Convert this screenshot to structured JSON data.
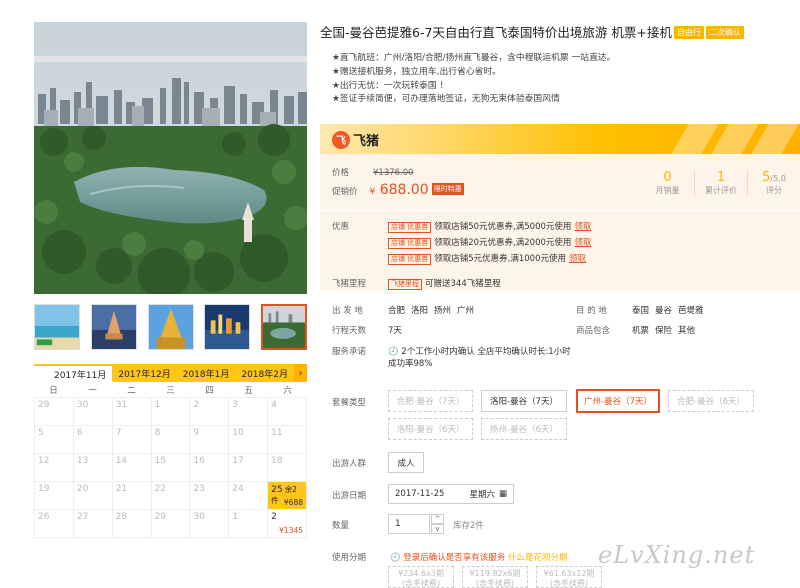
{
  "title": "全国-曼谷芭提雅6-7天自由行直飞泰国特价出境旅游 机票+接机",
  "title_tags": [
    "自由行",
    "二次确认"
  ],
  "features": [
    "★直飞航班：广州/洛阳/合肥/扬州直飞曼谷，含中程联运机票 一站直达。",
    "★赠送接机服务，独立用车,出行省心省时。",
    "★出行无忧：一次玩转泰国 ！",
    "★签证手续简便，可办理落地签证，无狗无束体验泰国风情"
  ],
  "brand": {
    "mark": "飞",
    "name": "飞猪"
  },
  "price": {
    "label": "价格",
    "original": "¥1376.00",
    "promo_label": "促销价",
    "currency": "¥",
    "promo": "688.00",
    "promo_tag": "限时特惠"
  },
  "stats": [
    {
      "value": "0",
      "label": "月销量"
    },
    {
      "value": "1",
      "label": "累计评价"
    },
    {
      "value": "5",
      "suffix": "/5.0",
      "label": "评分"
    }
  ],
  "coupons": {
    "label": "优惠",
    "tag": "店铺 优惠券",
    "items": [
      {
        "text": "领取店铺50元优惠券,满5000元使用",
        "action": "领取"
      },
      {
        "text": "领取店铺20元优惠券,满2000元使用",
        "action": "领取"
      },
      {
        "text": "领取店铺5元优惠券,满1000元使用",
        "action": "领取"
      }
    ]
  },
  "miles": {
    "label": "飞猪里程",
    "tag": "飞猪里程",
    "text": "可赠送344飞猪里程"
  },
  "info": {
    "departure_label": "出 发 地",
    "departures": [
      "合肥",
      "洛阳",
      "扬州",
      "广州"
    ],
    "destination_label": "目 的 地",
    "destinations": [
      "泰国",
      "曼谷",
      "芭堤雅"
    ],
    "days_label": "行程天数",
    "days": "7天",
    "includes_label": "商品包含",
    "includes": [
      "机票",
      "保险",
      "其他"
    ],
    "service_label": "服务承诺",
    "service_line1": "🕗 2个工作小时内确认 全店平均确认时长:1小时",
    "service_line2": "成功率98%"
  },
  "packages": {
    "label": "套餐类型",
    "items": [
      {
        "label": "合肥-曼谷（7天）",
        "state": "disabled"
      },
      {
        "label": "洛阳-曼谷（7天）",
        "state": "enabled"
      },
      {
        "label": "广州-曼谷（7天）",
        "state": "active"
      },
      {
        "label": "合肥-曼谷（6天）",
        "state": "disabled"
      },
      {
        "label": "洛阳-曼谷（6天）",
        "state": "disabled"
      },
      {
        "label": "扬州-曼谷（6天）",
        "state": "disabled"
      }
    ]
  },
  "traveler": {
    "label": "出游人群",
    "value": "成人"
  },
  "date": {
    "label": "出游日期",
    "value": "2017-11-25",
    "weekday": "星期六",
    "icon": "▦"
  },
  "quantity": {
    "label": "数量",
    "value": "1",
    "stock": "库存2件",
    "up": "^",
    "down": "v"
  },
  "installment": {
    "label": "使用分期",
    "note": "🕘 登录后确认是否享有该服务",
    "link": "什么是花呗分期",
    "options": [
      {
        "line1": "¥234.6x3期",
        "line2": "(含手续费)"
      },
      {
        "line1": "¥119.82x6期",
        "line2": "(含手续费)"
      },
      {
        "line1": "¥61.63x12期",
        "line2": "(含手续费)"
      }
    ]
  },
  "calendar": {
    "months": [
      "2017年11月",
      "2017年12月",
      "2018年1月",
      "2018年2月"
    ],
    "active_month": 0,
    "arrow": "›",
    "weekdays": [
      "日",
      "一",
      "二",
      "三",
      "四",
      "五",
      "六"
    ],
    "days": [
      {
        "d": "29"
      },
      {
        "d": "30"
      },
      {
        "d": "31"
      },
      {
        "d": "1"
      },
      {
        "d": "2"
      },
      {
        "d": "3"
      },
      {
        "d": "4"
      },
      {
        "d": "5"
      },
      {
        "d": "6"
      },
      {
        "d": "7"
      },
      {
        "d": "8"
      },
      {
        "d": "9"
      },
      {
        "d": "10"
      },
      {
        "d": "11"
      },
      {
        "d": "12"
      },
      {
        "d": "13"
      },
      {
        "d": "14"
      },
      {
        "d": "15"
      },
      {
        "d": "16"
      },
      {
        "d": "17"
      },
      {
        "d": "18"
      },
      {
        "d": "19"
      },
      {
        "d": "20"
      },
      {
        "d": "21"
      },
      {
        "d": "22"
      },
      {
        "d": "23"
      },
      {
        "d": "24"
      },
      {
        "d": "25",
        "extra": "余2件",
        "price": "¥688",
        "selected": true
      },
      {
        "d": "26"
      },
      {
        "d": "27"
      },
      {
        "d": "28"
      },
      {
        "d": "29"
      },
      {
        "d": "30"
      },
      {
        "d": "1"
      },
      {
        "d": "2",
        "price": "¥1345",
        "available": true
      }
    ]
  },
  "watermark": "eLvXing.net",
  "colors": {
    "accent": "#ffc619",
    "price": "#e2511f",
    "tint": "#fff4ea"
  }
}
